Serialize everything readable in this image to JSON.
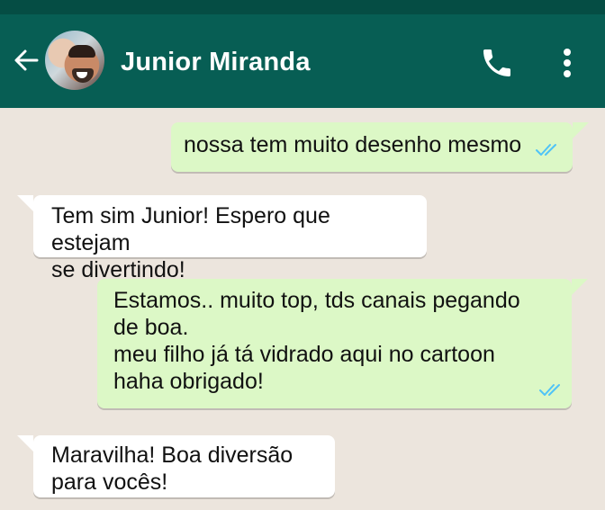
{
  "header": {
    "contact_name": "Junior Miranda",
    "back_icon": "arrow-left-icon",
    "call_icon": "phone-icon",
    "menu_icon": "more-vertical-icon"
  },
  "messages": [
    {
      "direction": "outgoing",
      "text": "nossa tem muito desenho mesmo",
      "status": "read"
    },
    {
      "direction": "incoming",
      "text": "Tem sim Junior! Espero que estejam\nse divertindo!"
    },
    {
      "direction": "outgoing",
      "text": "Estamos.. muito top, tds canais pegando\nde boa.\nmeu filho já tá vidrado aqui no cartoon\nhaha obrigado!",
      "status": "read"
    },
    {
      "direction": "incoming",
      "text": "Maravilha! Boa diversão\npara vocês!"
    }
  ],
  "colors": {
    "header_bg": "#075E54",
    "chat_bg": "#ECE5DD",
    "outgoing_bubble": "#DCF8C6",
    "incoming_bubble": "#FFFFFF",
    "read_ticks": "#4FC3F7"
  }
}
